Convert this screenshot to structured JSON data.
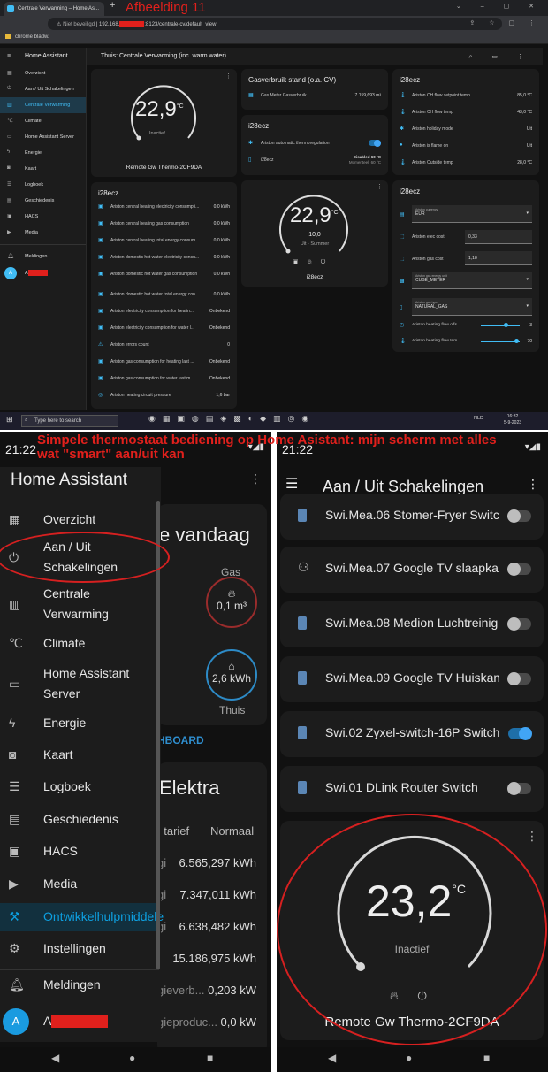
{
  "browser": {
    "tab_title": "Centrale Verwarming – Home As...",
    "afbeelding": "Afbeelding 11",
    "url_security": "Niet beveiligd",
    "url_prefix": "192.168.",
    "url_suffix": ":8123/centrale-cv/default_view",
    "bookmark": "chrome bladw."
  },
  "desktop": {
    "sidebar_title": "Home Assistant",
    "sidebar_items": [
      "Overzicht",
      "Aan / Uit Schakelingen",
      "Centrale Verwarming",
      "Climate",
      "Home Assistant Server",
      "Energie",
      "Kaart",
      "Logboek",
      "Geschiedenis",
      "HACS",
      "Media"
    ],
    "notifications": "Meldingen",
    "user_initial": "A",
    "user_name_start": "A",
    "page_title": "Thuis: Centrale Verwarming (inc. warm water)",
    "thermo1": {
      "temp": "22,9",
      "unit": "°C",
      "state": "Inactief",
      "name": "Remote Gw Thermo-2CF9DA"
    },
    "gas": {
      "title": "Gasverbruik stand (o.a. CV)",
      "label": "Gas Meter Gasverbruik",
      "value": "7.159,693 m³"
    },
    "card_mid": {
      "title": "i28ecz",
      "row1": "Ariston automatic thermoregulation",
      "row2": "i28ecz",
      "row2_val": "Disabled 60 °C",
      "row2_sub": "Momenteel: 60 °C"
    },
    "thermo2": {
      "temp": "22,9",
      "unit": "°C",
      "target": "10,0",
      "state": "Uit - Summer",
      "name": "i28ecz"
    },
    "right1": {
      "title": "i28ecz",
      "rows": [
        {
          "label": "Ariston CH flow setpoint temp",
          "value": "85,0 °C"
        },
        {
          "label": "Ariston CH flow temp",
          "value": "43,0 °C"
        },
        {
          "label": "Ariston holiday mode",
          "value": "Uit"
        },
        {
          "label": "Ariston is flame on",
          "value": "Uit"
        },
        {
          "label": "Ariston Outside temp",
          "value": "28,0 °C"
        }
      ]
    },
    "right2": {
      "title": "i28ecz",
      "currency_label": "Ariston currency",
      "currency": "EUR",
      "elec_label": "Ariston elec cost",
      "elec": "0,33",
      "gascost_label": "Ariston gas cost",
      "gascost": "1,18",
      "unit_label": "Ariston gas energy unit",
      "unit": "CUBE_METER",
      "gastype_label": "Ariston gas type",
      "gastype": "NATURAL_GAS",
      "offset_label": "Ariston heating flow offs...",
      "offset": "3",
      "flowtemp_label": "Ariston heating flow tem...",
      "flowtemp": "70"
    },
    "left2": {
      "title": "i28ecz",
      "rows": [
        {
          "label": "Ariston central heating electricity consumpti...",
          "value": "0,0 kWh"
        },
        {
          "label": "Ariston central heating gas consumption",
          "value": "0,0 kWh"
        },
        {
          "label": "Ariston central heating total energy consum...",
          "value": "0,0 kWh"
        },
        {
          "label": "Ariston domestic hot water electricity consu...",
          "value": "0,0 kWh"
        },
        {
          "label": "Ariston domestic hot water gas consumption",
          "value": "0,0 kWh"
        },
        {
          "label": "Ariston domestic hot water total energy con...",
          "value": "0,0 kWh"
        },
        {
          "label": "Ariston electricity consumption for heatin...",
          "value": "Onbekend"
        },
        {
          "label": "Ariston electricity consumption for water l...",
          "value": "Onbekend"
        },
        {
          "label": "Ariston errors count",
          "value": "0"
        },
        {
          "label": "Ariston gas consumption for heating last ...",
          "value": "Onbekend"
        },
        {
          "label": "Ariston gas consumption for water last m...",
          "value": "Onbekend"
        },
        {
          "label": "Ariston heating circuit pressure",
          "value": "1,6 bar"
        }
      ]
    },
    "taskbar": {
      "search": "Type here to search",
      "lang": "NLD",
      "time": "16:32",
      "date": "5-9-2023"
    }
  },
  "caption": "Simpele thermostaat bediening op Home Asistant: mijn scherm met alles wat \"smart\" aan/uit kan",
  "phone1": {
    "time": "21:22",
    "title": "Home Assistant",
    "items": [
      "Overzicht",
      "Aan / Uit",
      "Schakelingen",
      "Centrale",
      "Verwarming",
      "Climate",
      "Home Assistant",
      "Server",
      "Energie",
      "Kaart",
      "Logboek",
      "Geschiedenis",
      "HACS",
      "Media",
      "Ontwikkelhulpmiddele",
      "Instellingen"
    ],
    "notifications": "Meldingen",
    "user_initial": "A",
    "user_name_start": "A",
    "bg": {
      "energy_title": "e vandaag",
      "gas": "Gas",
      "gas_val": "0,1 m³",
      "home_val": "2,6 kWh",
      "thuis": "Thuis",
      "dashboard": "HBOARD",
      "elektra": "Elektra",
      "tariff": "f tarief",
      "normaal": "Normaal",
      "vals": [
        [
          "gi",
          "6.565,297 kWh"
        ],
        [
          "gi",
          "7.347,011 kWh"
        ],
        [
          "gi",
          "6.638,482 kWh"
        ],
        [
          "",
          "15.186,975 kWh"
        ],
        [
          "gieverb...",
          "0,203 kW"
        ],
        [
          "gieproduc...",
          "0,0 kW"
        ]
      ]
    }
  },
  "phone2": {
    "time": "21:22",
    "title": "Aan / Uit Schakelingen",
    "switches": [
      {
        "label": "Swi.Mea.06 Stomer-Fryer Switch",
        "on": false
      },
      {
        "label": "Swi.Mea.07 Google TV slaapka...",
        "on": false
      },
      {
        "label": "Swi.Mea.08 Medion Luchtreinig...",
        "on": false
      },
      {
        "label": "Swi.Mea.09 Google TV Huiskam...",
        "on": false
      },
      {
        "label": "Swi.02 Zyxel-switch-16P Switch",
        "on": true
      },
      {
        "label": "Swi.01 DLink Router Switch",
        "on": false
      }
    ],
    "thermo": {
      "temp": "23,2",
      "unit": "°C",
      "state": "Inactief",
      "name": "Remote Gw Thermo-2CF9DA"
    }
  },
  "colors": {
    "accent": "#41bdf5",
    "annotation_red": "#e0201c"
  }
}
